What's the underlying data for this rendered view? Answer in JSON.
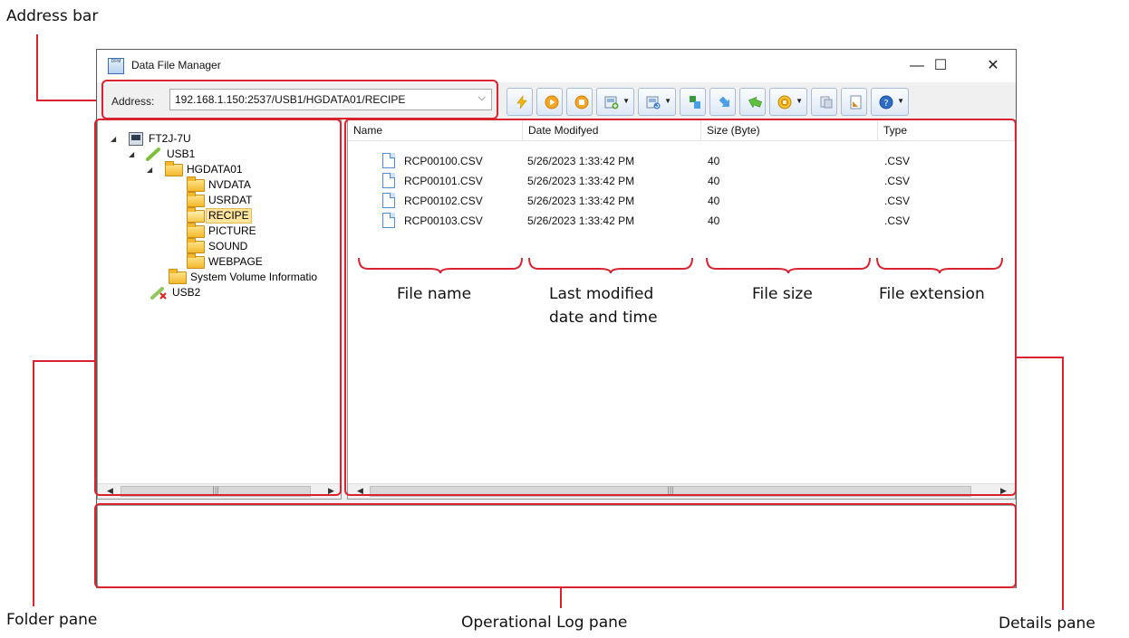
{
  "window": {
    "title": "Data File Manager",
    "icon_text": "DFM",
    "controls": {
      "minimize": "—",
      "maximize": "☐",
      "close": "✕"
    }
  },
  "address": {
    "label": "Address:",
    "value": "192.168.1.150:2537/USB1/HGDATA01/RECIPE"
  },
  "toolbar": {
    "buttons": [
      {
        "name": "connect",
        "icon": "lightning-icon",
        "color": "#f2b705",
        "dropdown": false
      },
      {
        "name": "run",
        "icon": "play-icon",
        "color": "#f29b1d",
        "dropdown": false
      },
      {
        "name": "stop",
        "icon": "stop-icon",
        "color": "#f29b1d",
        "dropdown": false
      },
      {
        "name": "new-folder",
        "icon": "new-folder-icon",
        "color": "#5aa63a",
        "dropdown": true
      },
      {
        "name": "refresh",
        "icon": "refresh-icon",
        "color": "#3b7dd8",
        "dropdown": true
      },
      {
        "name": "upload",
        "icon": "upload-icon",
        "color": "#3b9a3b",
        "dropdown": false
      },
      {
        "name": "download",
        "icon": "download-icon",
        "color": "#4aa0e6",
        "dropdown": false
      },
      {
        "name": "back",
        "icon": "back-arrow-icon",
        "color": "#5fbf3f",
        "dropdown": false
      },
      {
        "name": "settings",
        "icon": "settings-icon",
        "color": "#e2a50a",
        "dropdown": true
      },
      {
        "name": "copy",
        "icon": "copy-icon",
        "color": "#8a9bb5",
        "dropdown": false
      },
      {
        "name": "export",
        "icon": "export-icon",
        "color": "#d48a1e",
        "dropdown": false
      },
      {
        "name": "help",
        "icon": "help-icon",
        "color": "#2d6cc6",
        "dropdown": true
      }
    ]
  },
  "tree": {
    "items": [
      {
        "label": "FT2J-7U",
        "expander": "◢",
        "icon": "device-icon",
        "selected": false
      },
      {
        "label": "USB1",
        "expander": "◢",
        "icon": "usb-icon",
        "selected": false
      },
      {
        "label": "HGDATA01",
        "expander": "◢",
        "icon": "folder-icon",
        "selected": false
      },
      {
        "label": "NVDATA",
        "expander": "",
        "icon": "folder-icon",
        "selected": false
      },
      {
        "label": "USRDAT",
        "expander": "",
        "icon": "folder-icon",
        "selected": false
      },
      {
        "label": "RECIPE",
        "expander": "",
        "icon": "folder-open-icon",
        "selected": true
      },
      {
        "label": "PICTURE",
        "expander": "",
        "icon": "folder-icon",
        "selected": false
      },
      {
        "label": "SOUND",
        "expander": "",
        "icon": "folder-icon",
        "selected": false
      },
      {
        "label": "WEBPAGE",
        "expander": "",
        "icon": "folder-icon",
        "selected": false
      },
      {
        "label": "System Volume Informatio",
        "expander": "",
        "icon": "folder-icon",
        "selected": false
      },
      {
        "label": "USB2",
        "expander": "",
        "icon": "usb-disconnected-icon",
        "selected": false
      }
    ]
  },
  "details": {
    "columns": [
      "Name",
      "Date Modifyed",
      "Size (Byte)",
      "Type"
    ],
    "rows": [
      {
        "name": "RCP00100.CSV",
        "date": "5/26/2023 1:33:42 PM",
        "size": "40",
        "type": ".CSV"
      },
      {
        "name": "RCP00101.CSV",
        "date": "5/26/2023 1:33:42 PM",
        "size": "40",
        "type": ".CSV"
      },
      {
        "name": "RCP00102.CSV",
        "date": "5/26/2023 1:33:42 PM",
        "size": "40",
        "type": ".CSV"
      },
      {
        "name": "RCP00103.CSV",
        "date": "5/26/2023 1:33:42 PM",
        "size": "40",
        "type": ".CSV"
      }
    ]
  },
  "scrollbar": {
    "left": "◀",
    "right": "▶",
    "grip": "|||"
  },
  "annotations": {
    "address_bar": "Address bar",
    "folder_pane": "Folder pane",
    "log_pane": "Operational Log pane",
    "details_pane": "Details pane",
    "file_name": "File name",
    "last_modified_1": "Last modified",
    "last_modified_2": "date and time",
    "file_size": "File size",
    "file_extension": "File extension",
    "color": "#d9232e"
  }
}
